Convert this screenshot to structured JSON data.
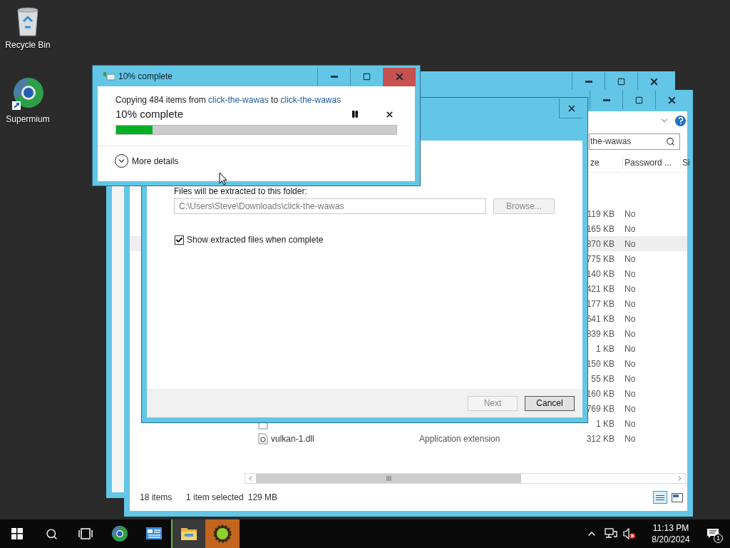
{
  "desktop_icons": [
    {
      "kind": "recycle_bin",
      "label": "Recycle Bin"
    },
    {
      "kind": "browser",
      "label": "Supermium"
    }
  ],
  "explorer": {
    "search_value": "the-wawas",
    "columns": [
      "ze",
      "Password ...",
      "Si"
    ],
    "rows": [
      {
        "size": "119 KB",
        "password": "No",
        "selected": false
      },
      {
        "size": "165 KB",
        "password": "No",
        "selected": false
      },
      {
        "size": "870 KB",
        "password": "No",
        "selected": true
      },
      {
        "size": "775 KB",
        "password": "No",
        "selected": false
      },
      {
        "size": "140 KB",
        "password": "No",
        "selected": false
      },
      {
        "size": "421 KB",
        "password": "No",
        "selected": false
      },
      {
        "size": "177 KB",
        "password": "No",
        "selected": false
      },
      {
        "size": "641 KB",
        "password": "No",
        "selected": false
      },
      {
        "size": "839 KB",
        "password": "No",
        "selected": false
      },
      {
        "size": "1 KB",
        "password": "No",
        "selected": false
      },
      {
        "size": "150 KB",
        "password": "No",
        "selected": false
      },
      {
        "size": "55 KB",
        "password": "No",
        "selected": false
      },
      {
        "size": "160 KB",
        "password": "No",
        "selected": false
      },
      {
        "size": "769 KB",
        "password": "No",
        "selected": false
      },
      {
        "kind": "json",
        "size": "1 KB",
        "password": "No",
        "selected": false
      },
      {
        "kind": "dll",
        "name": "vulkan-1.dll",
        "type": "Application extension",
        "size": "312 KB",
        "password": "No",
        "selected": false
      }
    ],
    "status_bar": {
      "item_count": "18 items",
      "selection": "1 item selected",
      "selection_size": "129 MB"
    }
  },
  "extract_wizard": {
    "folder_label": "Files will be extracted to this folder:",
    "folder_field": {
      "value": "C:\\Users\\Steve\\Downloads\\click-the-wawas",
      "disabled": true
    },
    "browse_button": {
      "label": "Browse...",
      "disabled": true
    },
    "show_files": {
      "label": "Show extracted files when complete",
      "checked": true
    },
    "buttons": [
      {
        "label": "Next",
        "disabled": true
      },
      {
        "label": "Cancel",
        "disabled": false
      }
    ]
  },
  "copy_dialog": {
    "title": "10% complete",
    "message": {
      "prefix": "Copying 484 items from",
      "source": "click-the-wawas",
      "middle": "to",
      "destination": "click-the-wawas"
    },
    "heading": "10% complete",
    "progress": {
      "level": 0.13
    },
    "details": {
      "label": "More details",
      "expanded": false
    }
  },
  "taskbar": {
    "apps": [
      {
        "kind": "browser",
        "active": false,
        "flashing": false
      },
      {
        "kind": "control_panel",
        "active": false,
        "flashing": false
      },
      {
        "kind": "file_explorer",
        "active": true,
        "flashing": false
      },
      {
        "kind": "gear_app",
        "active": false,
        "flashing": true
      }
    ],
    "clock": {
      "time": "11:13 PM",
      "date": "8/20/2024"
    },
    "notifications": "1"
  }
}
